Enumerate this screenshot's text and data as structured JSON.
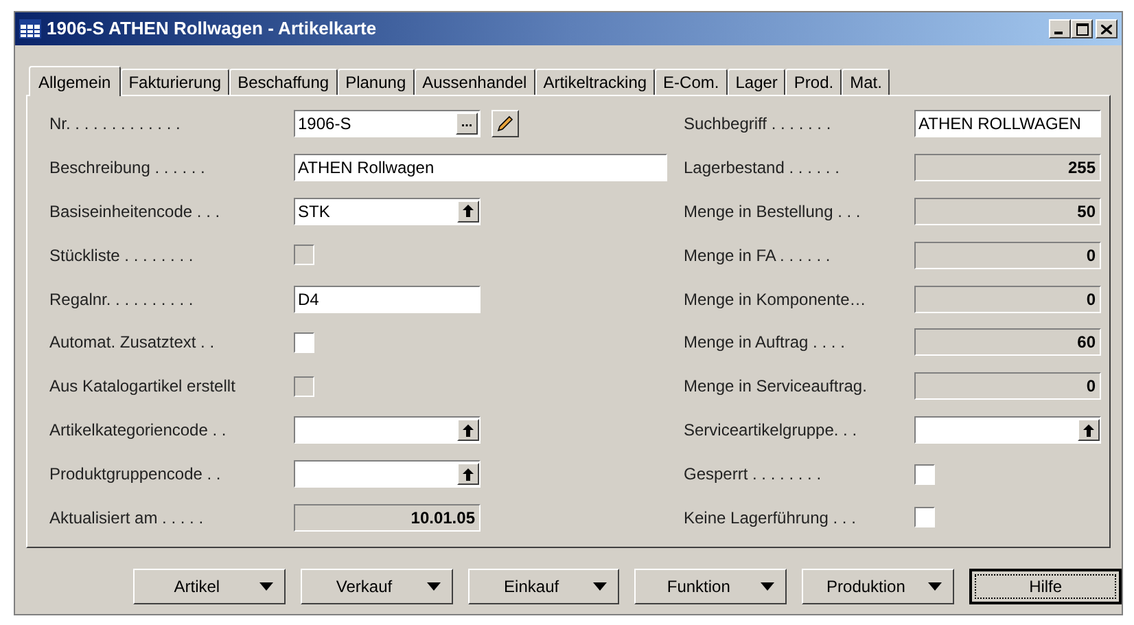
{
  "window": {
    "title": "1906-S ATHEN Rollwagen - Artikelkarte"
  },
  "tabs": [
    {
      "label": "Allgemein",
      "selected": true
    },
    {
      "label": "Fakturierung",
      "selected": false
    },
    {
      "label": "Beschaffung",
      "selected": false
    },
    {
      "label": "Planung",
      "selected": false
    },
    {
      "label": "Aussenhandel",
      "selected": false
    },
    {
      "label": "Artikeltracking",
      "selected": false
    },
    {
      "label": "E-Com.",
      "selected": false
    },
    {
      "label": "Lager",
      "selected": false
    },
    {
      "label": "Prod.",
      "selected": false
    },
    {
      "label": "Mat.",
      "selected": false
    }
  ],
  "left_fields": [
    {
      "kind": "lookup",
      "label": "Nr. . . . . . . . . . . . .",
      "value": "1906-S",
      "button": "..."
    },
    {
      "kind": "long_text",
      "label": "Beschreibung . . . . . .",
      "value": "ATHEN Rollwagen"
    },
    {
      "kind": "dropdown",
      "label": "Basiseinheitencode . . .",
      "value": "STK"
    },
    {
      "kind": "checkbox",
      "label": "Stückliste . . . . . . . .",
      "checked": false,
      "disabled": true
    },
    {
      "kind": "text",
      "label": "Regalnr. . . . . . . . . .",
      "value": "D4"
    },
    {
      "kind": "checkbox",
      "label": "Automat. Zusatztext . .",
      "checked": false,
      "disabled": false
    },
    {
      "kind": "checkbox",
      "label": "Aus Katalogartikel erstellt",
      "checked": false,
      "disabled": true
    },
    {
      "kind": "dropdown",
      "label": "Artikelkategoriencode . ."
    },
    {
      "kind": "dropdown",
      "label": "Produktgruppencode . ."
    },
    {
      "kind": "readonly",
      "label": "Aktualisiert am . . . . .",
      "value": "10.01.05"
    }
  ],
  "right_fields": [
    {
      "kind": "text",
      "label": "Suchbegriff . . . . . . .",
      "value": "ATHEN ROLLWAGEN"
    },
    {
      "kind": "readonly",
      "label": "Lagerbestand . . . . . .",
      "value": "255"
    },
    {
      "kind": "readonly",
      "label": "Menge in Bestellung . . .",
      "value": "50"
    },
    {
      "kind": "readonly",
      "label": "Menge in FA . . . . . .",
      "value": "0"
    },
    {
      "kind": "readonly",
      "label": "Menge in Komponente…",
      "value": "0"
    },
    {
      "kind": "readonly",
      "label": "Menge in Auftrag . . . .",
      "value": "60"
    },
    {
      "kind": "readonly",
      "label": "Menge in Serviceauftrag.",
      "value": "0"
    },
    {
      "kind": "dropdown",
      "label": "Serviceartikelgruppe. . ."
    },
    {
      "kind": "checkbox",
      "label": "Gesperrt . . . . . . . .",
      "checked": false,
      "disabled": false
    },
    {
      "kind": "checkbox",
      "label": "Keine Lagerführung . . .",
      "checked": false,
      "disabled": false
    }
  ],
  "buttons": [
    {
      "kind": "menu",
      "label": "Artikel"
    },
    {
      "kind": "menu",
      "label": "Verkauf"
    },
    {
      "kind": "menu",
      "label": "Einkauf"
    },
    {
      "kind": "menu",
      "label": "Funktion"
    },
    {
      "kind": "menu",
      "label": "Produktion"
    },
    {
      "kind": "default",
      "label": "Hilfe"
    }
  ]
}
